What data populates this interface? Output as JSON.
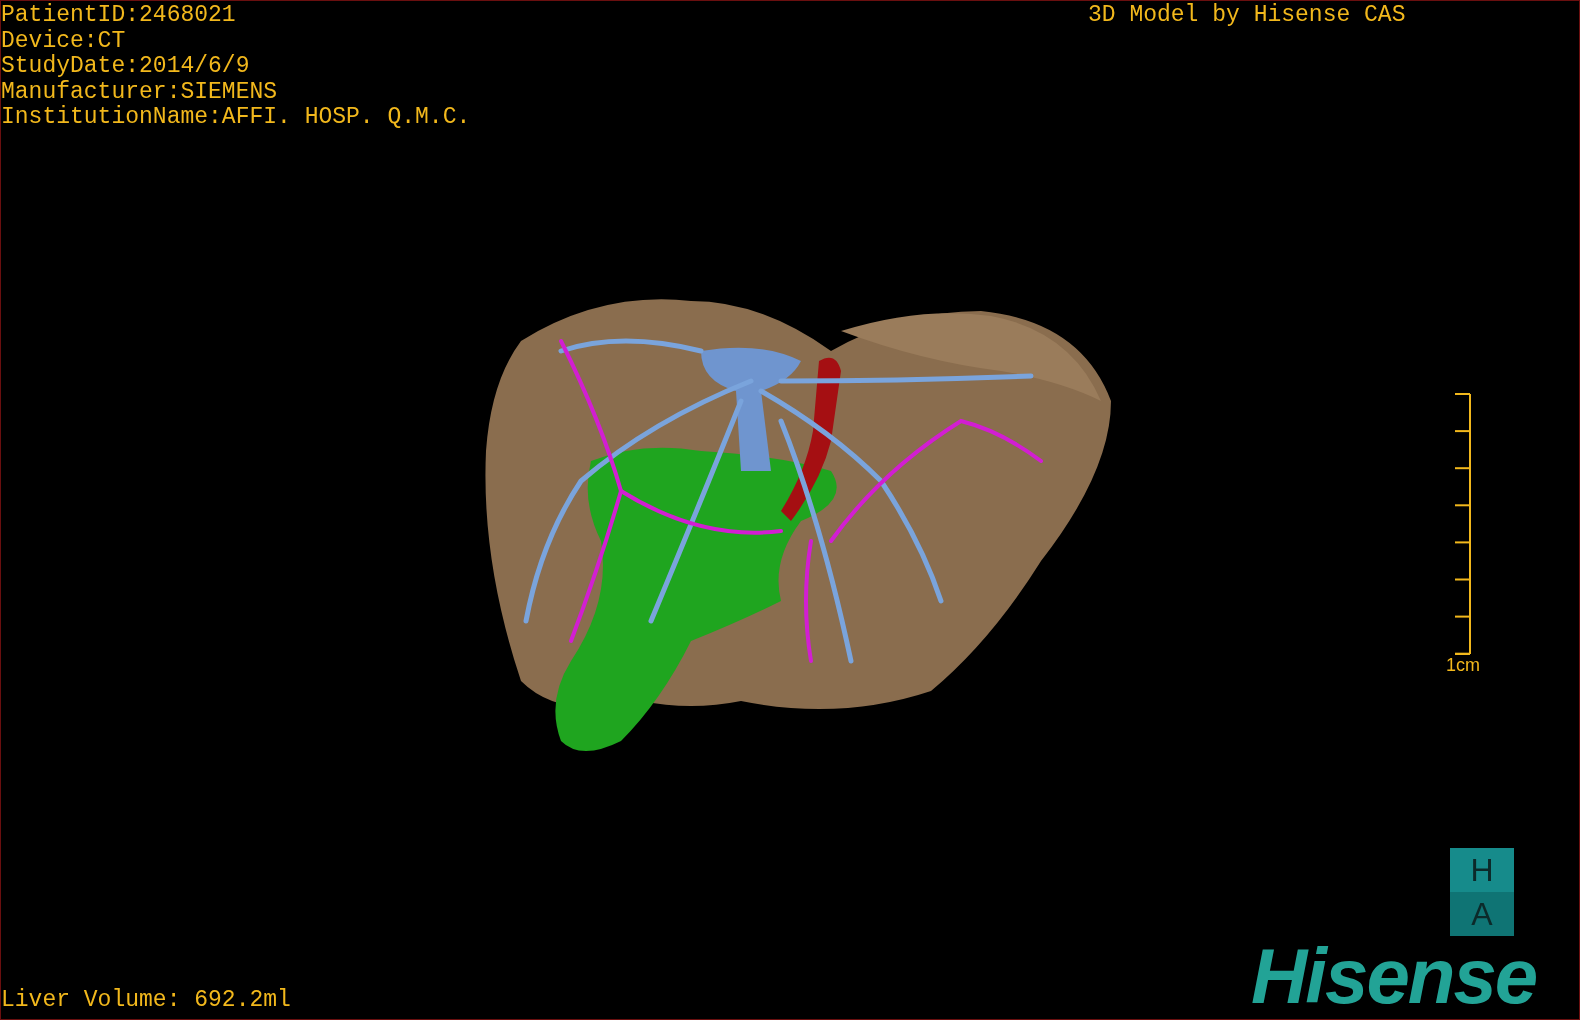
{
  "study_info": [
    "PatientID:2468021",
    "Device:CT",
    "StudyDate:2014/6/9",
    "Manufacturer:SIEMENS",
    "InstitutionName:AFFI. HOSP. Q.M.C."
  ],
  "model_title": "3D Model by Hisense CAS",
  "scale_bar": {
    "label": "1cm"
  },
  "orientation_marker": [
    "H",
    "A"
  ],
  "liver_volume": "Liver Volume: 692.2ml",
  "logo": "Hisense"
}
